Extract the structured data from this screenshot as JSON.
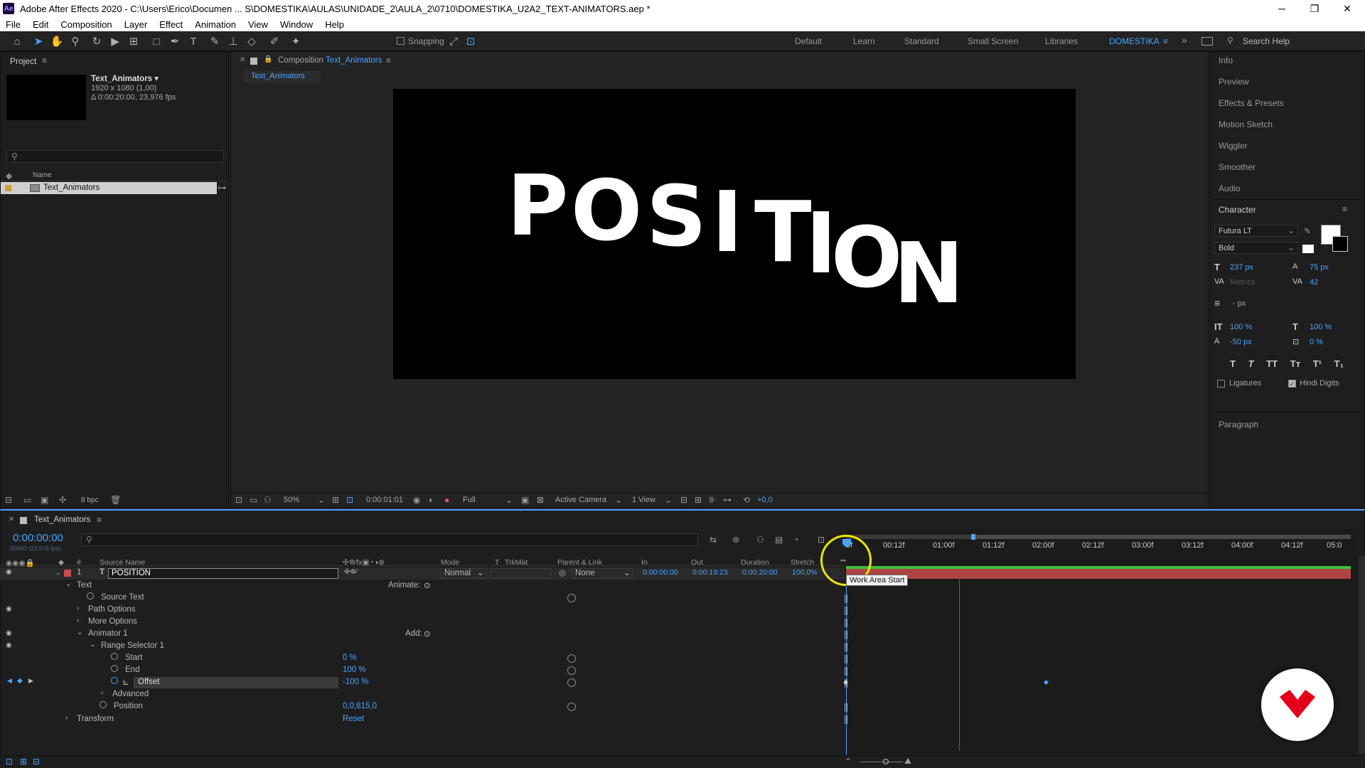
{
  "window": {
    "title": "Adobe After Effects 2020 - C:\\Users\\Erico\\Documen ... S\\DOMESTIKA\\AULAS\\UNIDADE_2\\AULA_2\\0710\\DOMESTIKA_U2A2_TEXT-ANIMATORS.aep *",
    "logo": "Ae",
    "minimize": "─",
    "maximize": "❐",
    "close": "✕"
  },
  "menu": [
    "File",
    "Edit",
    "Composition",
    "Layer",
    "Effect",
    "Animation",
    "View",
    "Window",
    "Help"
  ],
  "toolbar": {
    "snapping": "Snapping",
    "workspaces": [
      "Default",
      "Learn",
      "Standard",
      "Small Screen",
      "Libraries",
      "DOMESTIKA"
    ],
    "search": "Search Help",
    "more": "»"
  },
  "project": {
    "title": "Project",
    "comp_name": "Text_Animators ▾",
    "comp_size": "1920 x 1080 (1,00)",
    "comp_duration": "Δ 0:00:20:00, 23,976 fps",
    "col_name": "Name",
    "item": "Text_Animators",
    "bpc": "8 bpc"
  },
  "comp": {
    "tab_prefix": "Composition",
    "tab_name": "Text_Animators",
    "subtab": "Text_Animators",
    "text": "POSITION",
    "zoom": "50%",
    "timecode": "0:00:01:01",
    "resolution": "Full",
    "camera": "Active Camera",
    "view": "1 View",
    "exposure": "+0,0"
  },
  "right": {
    "items": [
      "Info",
      "Preview",
      "Effects & Presets",
      "Motion Sketch",
      "Wiggler",
      "Smoother",
      "Audio"
    ],
    "character": "Character",
    "font": "Futura LT",
    "style": "Bold",
    "size": "237 px",
    "leading": "75 px",
    "kerning": "Metrics",
    "tracking": "42",
    "stroke_unit": "- px",
    "vscale": "100 %",
    "hscale": "100 %",
    "baseline": "-50 px",
    "tsume": "0 %",
    "ligatures": "Ligatures",
    "hindi": "Hindi Digits",
    "paragraph": "Paragraph",
    "fill_color": "#ffffff",
    "stroke_color": "#000000"
  },
  "timeline": {
    "tab": "Text_Animators",
    "timecode": "0:00:00:00",
    "fps": "00000 (23.976 fps)",
    "headers": {
      "num": "#",
      "source": "Source Name",
      "mode": "Mode",
      "t": "T",
      "trkmat": "TrkMat",
      "parent": "Parent & Link",
      "in": "In",
      "out": "Out",
      "duration": "Duration",
      "stretch": "Stretch"
    },
    "layer": {
      "num": "1",
      "type": "T",
      "name": "POSITION",
      "mode": "Normal",
      "parent": "None",
      "in": "0:00:00:00",
      "out": "0:00:19:23",
      "duration": "0:00:20:00",
      "stretch": "100,0%"
    },
    "rows": {
      "text": "Text",
      "animate": "Animate:",
      "source_text": "Source Text",
      "path_options": "Path Options",
      "more_options": "More Options",
      "animator": "Animator 1",
      "add": "Add:",
      "range": "Range Selector 1",
      "start": "Start",
      "start_val": "0 %",
      "end": "End",
      "end_val": "100 %",
      "offset": "Offset",
      "offset_val": "-100 %",
      "advanced": "Advanced",
      "position": "Position",
      "position_val": "0,0,615,0",
      "transform": "Transform",
      "reset": "Reset"
    },
    "ruler": [
      "0f",
      "00:12f",
      "01:00f",
      "01:12f",
      "02:00f",
      "02:12f",
      "03:00f",
      "03:12f",
      "04:00f",
      "04:12f",
      "05:0"
    ],
    "tooltip": "Work Area Start"
  },
  "colors": {
    "accent": "#4aa3ff",
    "layer_bar": "#c84b4b",
    "work_area": "#3fbf3f",
    "logo_red": "#e2001a"
  }
}
